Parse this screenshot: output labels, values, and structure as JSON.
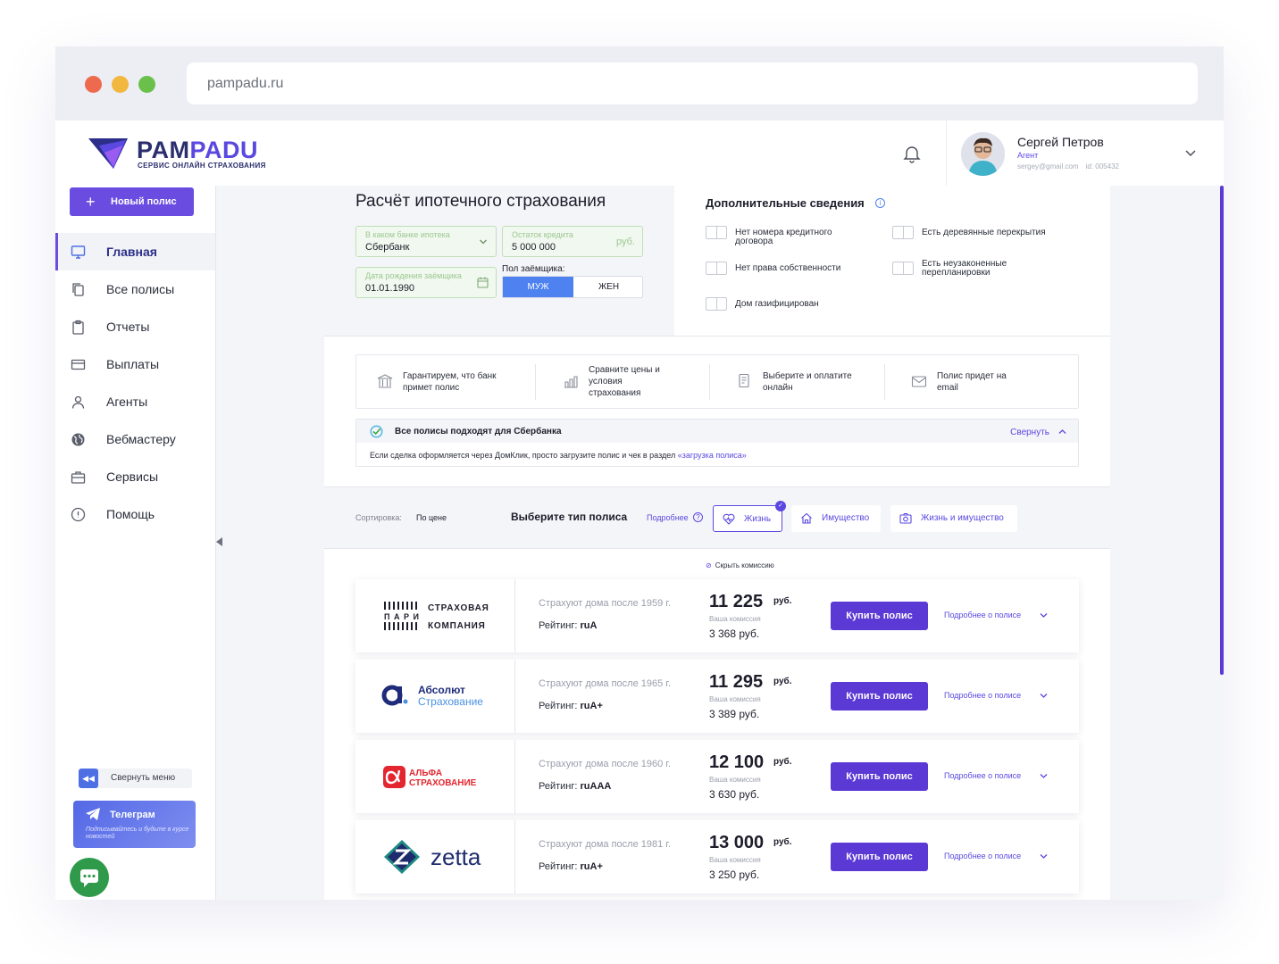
{
  "browser": {
    "url": "pampadu.ru"
  },
  "header": {
    "logo_main": "PAM",
    "logo_accent": "PADU",
    "logo_sub": "СЕРВИС ОНЛАЙН СТРАХОВАНИЯ",
    "user": {
      "name": "Сергей Петров",
      "role": "Агент",
      "email": "sergey@gmail.com",
      "id": "id: 005432"
    }
  },
  "sidebar": {
    "new_policy_label": "Новый полис",
    "items": [
      {
        "label": "Главная",
        "icon": "monitor-icon",
        "active": true
      },
      {
        "label": "Все полисы",
        "icon": "copy-icon"
      },
      {
        "label": "Отчеты",
        "icon": "clipboard-icon"
      },
      {
        "label": "Выплаты",
        "icon": "card-icon"
      },
      {
        "label": "Агенты",
        "icon": "user-icon"
      },
      {
        "label": "Вебмастеру",
        "icon": "globe-icon"
      },
      {
        "label": "Сервисы",
        "icon": "briefcase-icon"
      },
      {
        "label": "Помощь",
        "icon": "alert-circle-icon"
      }
    ],
    "collapse_label": "Свернуть меню",
    "telegram": {
      "title": "Телеграм",
      "subtitle": "Подписывайтесь и будьте в курсе новостей"
    }
  },
  "calculator": {
    "title": "Расчёт ипотечного страхования",
    "bank": {
      "label": "В каком банке ипотека",
      "value": "Сбербанк"
    },
    "credit": {
      "label": "Остаток кредита",
      "value": "5 000 000",
      "suffix": "руб."
    },
    "birth": {
      "label": "Дата рождения заёмщика",
      "value": "01.01.1990"
    },
    "gender": {
      "label": "Пол заёмщика:",
      "male": "МУЖ",
      "female": "ЖЕН",
      "selected": "МУЖ"
    }
  },
  "extra": {
    "title": "Дополнительные сведения",
    "options": [
      {
        "label": "Нет номера кредитного договора",
        "checked": false
      },
      {
        "label": "Есть деревянные перекрытия",
        "checked": false
      },
      {
        "label": "Нет права собственности",
        "checked": false
      },
      {
        "label": "Есть неузаконенные перепланировки",
        "checked": false
      },
      {
        "label": "Дом газифицирован",
        "checked": false
      }
    ]
  },
  "benefits": [
    {
      "text": "Гарантируем, что банк примет полис",
      "icon": "bank-icon"
    },
    {
      "text": "Сравните цены и условия страхования",
      "icon": "chart-bars-icon"
    },
    {
      "text": "Выберите и оплатите онлайн",
      "icon": "document-icon"
    },
    {
      "text": "Полис придет на email",
      "icon": "envelope-icon"
    }
  ],
  "sber": {
    "title": "Все полисы подходят для Сбербанка",
    "collapse": "Свернуть",
    "text": "Если сделка оформляется через ДомКлик, просто загрузите полис и чек в раздел",
    "link": "«загрузка полиса»"
  },
  "filter": {
    "sort_label": "Сортировка:",
    "sort_value": "По цене",
    "type_title": "Выберите тип полиса",
    "more": "Подробнее",
    "types": [
      {
        "label": "Жизнь",
        "selected": true
      },
      {
        "label": "Имущество",
        "selected": false
      },
      {
        "label": "Жизнь и имущество",
        "selected": false
      }
    ]
  },
  "hide_commission": "Скрыть комиссию",
  "offers": [
    {
      "company": "Страховая компания Пари",
      "logo_lines": [
        "СТРАХОВАЯ",
        "ПАРИ",
        "КОМПАНИЯ"
      ],
      "house": "Страхуют дома после 1959 г.",
      "rating_label": "Рейтинг:",
      "rating": "ruA",
      "price": "11 225",
      "currency": "руб.",
      "commission_label": "Ваша комиссия",
      "commission": "3 368 руб.",
      "buy": "Купить полис",
      "details": "Подробнее о полисе"
    },
    {
      "company": "Абсолют Страхование",
      "logo_lines": [
        "Абсолют",
        "Страхование"
      ],
      "house": "Страхуют дома после 1965 г.",
      "rating_label": "Рейтинг:",
      "rating": "ruA+",
      "price": "11 295",
      "currency": "руб.",
      "commission_label": "Ваша комиссия",
      "commission": "3 389 руб.",
      "buy": "Купить полис",
      "details": "Подробнее о полисе"
    },
    {
      "company": "Альфа Страхование",
      "logo_lines": [
        "АЛЬФА",
        "СТРАХОВАНИЕ"
      ],
      "house": "Страхуют дома после 1960 г.",
      "rating_label": "Рейтинг:",
      "rating": "ruAAA",
      "price": "12 100",
      "currency": "руб.",
      "commission_label": "Ваша комиссия",
      "commission": "3 630 руб.",
      "buy": "Купить полис",
      "details": "Подробнее о полисе"
    },
    {
      "company": "zetta",
      "logo_lines": [
        "zetta"
      ],
      "house": "Страхуют дома после 1981 г.",
      "rating_label": "Рейтинг:",
      "rating": "ruA+",
      "price": "13 000",
      "currency": "руб.",
      "commission_label": "Ваша комиссия",
      "commission": "3 250 руб.",
      "buy": "Купить полис",
      "details": "Подробнее о полисе"
    }
  ],
  "colors": {
    "accent": "#5b39d4",
    "blue": "#4e82f0",
    "success": "#2e9a4a"
  }
}
